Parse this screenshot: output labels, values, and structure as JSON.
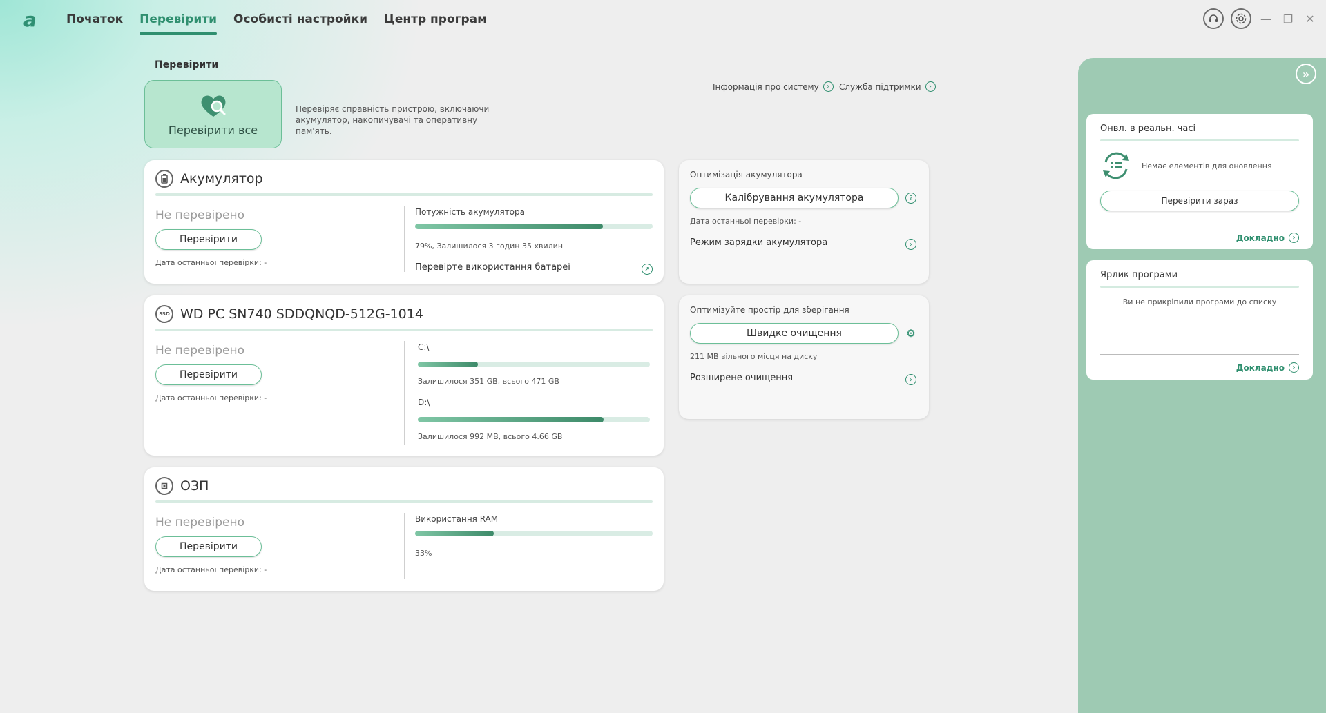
{
  "app": {
    "logo": "a"
  },
  "nav": {
    "tabs": [
      {
        "label": "Початок"
      },
      {
        "label": "Перевірити"
      },
      {
        "label": "Особисті настройки"
      },
      {
        "label": "Центр програм"
      }
    ]
  },
  "page": {
    "heading": "Перевірити",
    "check_all_label": "Перевірити все",
    "check_all_desc": "Перевіряє справність пристрою, включаючи акумулятор, накопичувачі та оперативну пам'ять.",
    "link_sysinfo": "Інформація про систему",
    "link_support": "Служба підтримки"
  },
  "battery": {
    "title": "Акумулятор",
    "status": "Не перевірено",
    "check_btn": "Перевірити",
    "last_check": "Дата останньої перевірки: -",
    "metric_label": "Потужність акумулятора",
    "metric_percent": 79,
    "metric_info": "79%, Залишилося 3 годин 35 хвилин",
    "action": "Перевірте використання батареї"
  },
  "disk": {
    "title": "WD PC SN740 SDDQNQD-512G-1014",
    "icon_text": "SSD",
    "status": "Не перевірено",
    "check_btn": "Перевірити",
    "last_check": "Дата останньої перевірки: -",
    "c_label": "C:\\",
    "c_used_percent": 26,
    "c_info": "Залишилося 351 GB, всього 471 GB",
    "d_label": "D:\\",
    "d_used_percent": 80,
    "d_info": "Залишилося 992 MB, всього 4.66 GB"
  },
  "ram": {
    "title": "ОЗП",
    "status": "Не перевірено",
    "check_btn": "Перевірити",
    "last_check": "Дата останньої перевірки: -",
    "metric_label": "Використання RAM",
    "metric_percent": 33,
    "metric_info": "33%"
  },
  "battery_opt": {
    "title": "Оптимізація акумулятора",
    "btn": "Калібрування акумулятора",
    "last_check": "Дата останньої перевірки: -",
    "mode": "Режим зарядки акумулятора"
  },
  "storage_opt": {
    "title": "Оптимізуйте простір для зберігання",
    "btn": "Швидке очищення",
    "free_info": "211 MB вільного місця на диску",
    "advanced": "Розширене очищення"
  },
  "side": {
    "updates": {
      "title": "Онвл. в реальн. часі",
      "empty": "Немає елементів для оновлення",
      "btn": "Перевірити зараз",
      "more": "Докладно"
    },
    "shortcuts": {
      "title": "Ярлик програми",
      "empty": "Ви не прикріпили програми до списку",
      "more": "Докладно"
    }
  },
  "colors": {
    "accent": "#2f8f6f",
    "panel": "#9ecab3",
    "check_all_bg": "#b7e6cf"
  }
}
